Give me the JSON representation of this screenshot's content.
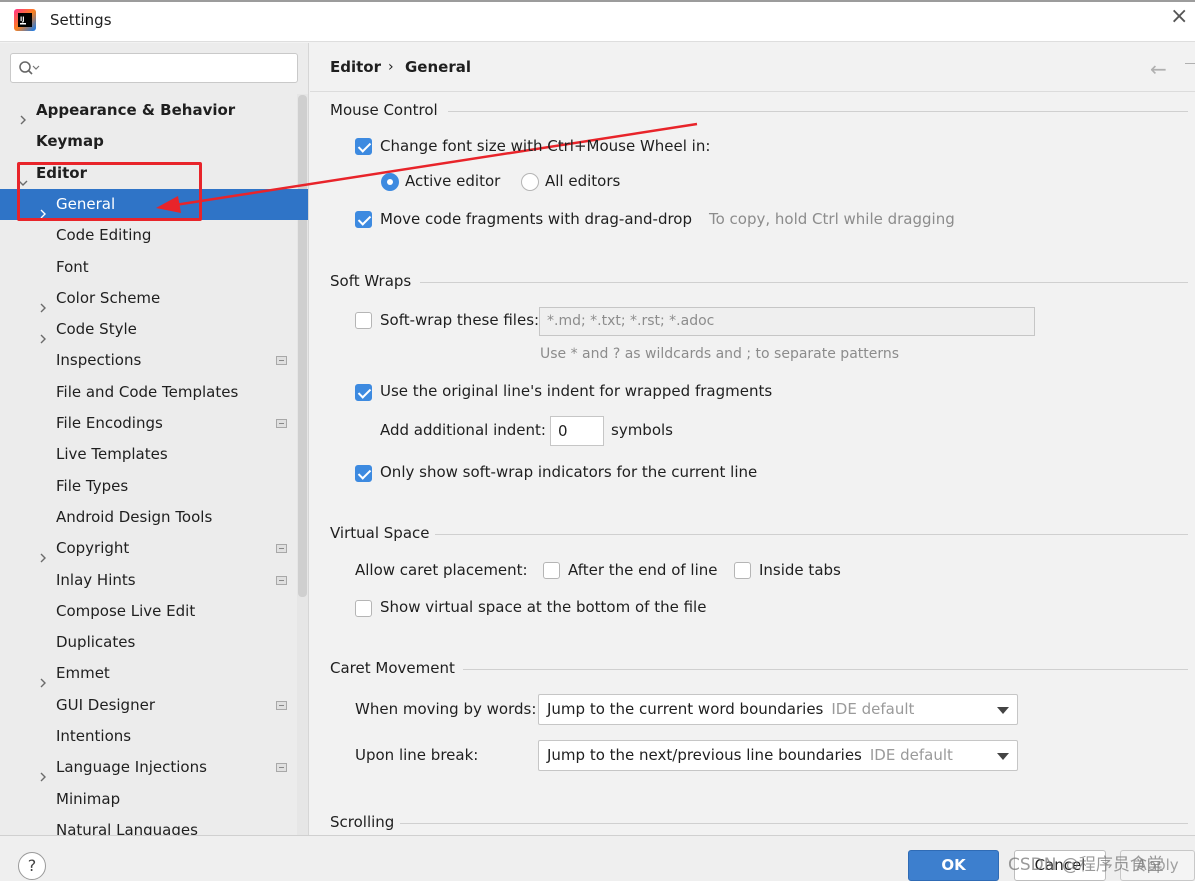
{
  "window": {
    "title": "Settings"
  },
  "search": {
    "placeholder": ""
  },
  "sidebar": {
    "items": [
      {
        "label": "Appearance & Behavior",
        "bold": true,
        "arrow": "right",
        "indent": 0
      },
      {
        "label": "Keymap",
        "bold": true,
        "arrow": "none",
        "indent": 0
      },
      {
        "label": "Editor",
        "bold": true,
        "arrow": "down",
        "indent": 0
      },
      {
        "label": "General",
        "selected": true,
        "arrow": "right",
        "indent": 1
      },
      {
        "label": "Code Editing",
        "arrow": "none",
        "indent": 1
      },
      {
        "label": "Font",
        "arrow": "none",
        "indent": 1
      },
      {
        "label": "Color Scheme",
        "arrow": "right",
        "indent": 1
      },
      {
        "label": "Code Style",
        "arrow": "right",
        "indent": 1
      },
      {
        "label": "Inspections",
        "arrow": "none",
        "indent": 1,
        "project": true
      },
      {
        "label": "File and Code Templates",
        "arrow": "none",
        "indent": 1
      },
      {
        "label": "File Encodings",
        "arrow": "none",
        "indent": 1,
        "project": true
      },
      {
        "label": "Live Templates",
        "arrow": "none",
        "indent": 1
      },
      {
        "label": "File Types",
        "arrow": "none",
        "indent": 1
      },
      {
        "label": "Android Design Tools",
        "arrow": "none",
        "indent": 1
      },
      {
        "label": "Copyright",
        "arrow": "right",
        "indent": 1,
        "project": true
      },
      {
        "label": "Inlay Hints",
        "arrow": "none",
        "indent": 1,
        "project": true
      },
      {
        "label": "Compose Live Edit",
        "arrow": "none",
        "indent": 1
      },
      {
        "label": "Duplicates",
        "arrow": "none",
        "indent": 1
      },
      {
        "label": "Emmet",
        "arrow": "right",
        "indent": 1
      },
      {
        "label": "GUI Designer",
        "arrow": "none",
        "indent": 1,
        "project": true
      },
      {
        "label": "Intentions",
        "arrow": "none",
        "indent": 1
      },
      {
        "label": "Language Injections",
        "arrow": "right",
        "indent": 1,
        "project": true
      },
      {
        "label": "Minimap",
        "arrow": "none",
        "indent": 1
      },
      {
        "label": "Natural Languages",
        "arrow": "right",
        "indent": 1
      }
    ]
  },
  "breadcrumb": {
    "parent": "Editor",
    "separator": "›",
    "current": "General"
  },
  "mouse_control": {
    "title": "Mouse Control",
    "change_font_size": {
      "label": "Change font size with Ctrl+Mouse Wheel in:",
      "checked": true
    },
    "active_editor": {
      "label": "Active editor",
      "selected": true
    },
    "all_editors": {
      "label": "All editors",
      "selected": false
    },
    "drag_drop": {
      "label": "Move code fragments with drag-and-drop",
      "checked": true
    },
    "drag_hint": "To copy, hold Ctrl while dragging"
  },
  "soft_wraps": {
    "title": "Soft Wraps",
    "soft_wrap_files": {
      "label": "Soft-wrap these files:",
      "checked": false
    },
    "patterns_value": "*.md; *.txt; *.rst; *.adoc",
    "patterns_hint": "Use * and ? as wildcards and ; to separate patterns",
    "original_indent": {
      "label": "Use the original line's indent for wrapped fragments",
      "checked": true
    },
    "additional_indent_label": "Add additional indent:",
    "additional_indent_value": "0",
    "symbols_label": "symbols",
    "only_current_line": {
      "label": "Only show soft-wrap indicators for the current line",
      "checked": true
    }
  },
  "virtual_space": {
    "title": "Virtual Space",
    "allow_caret_label": "Allow caret placement:",
    "after_end": {
      "label": "After the end of line",
      "checked": false
    },
    "inside_tabs": {
      "label": "Inside tabs",
      "checked": false
    },
    "show_bottom": {
      "label": "Show virtual space at the bottom of the file",
      "checked": false
    }
  },
  "caret_movement": {
    "title": "Caret Movement",
    "moving_words_label": "When moving by words:",
    "moving_words_value": "Jump to the current word boundaries",
    "moving_words_tag": "IDE default",
    "line_break_label": "Upon line break:",
    "line_break_value": "Jump to the next/previous line boundaries",
    "line_break_tag": "IDE default"
  },
  "scrolling": {
    "title": "Scrolling"
  },
  "footer": {
    "help": "?",
    "ok": "OK",
    "cancel": "Cancel",
    "apply": "Apply",
    "watermark": "CSDN @程序员食堂"
  },
  "colors": {
    "selection": "#2f74c7",
    "accent": "#3d8ae0",
    "annotation": "#e8242a"
  }
}
